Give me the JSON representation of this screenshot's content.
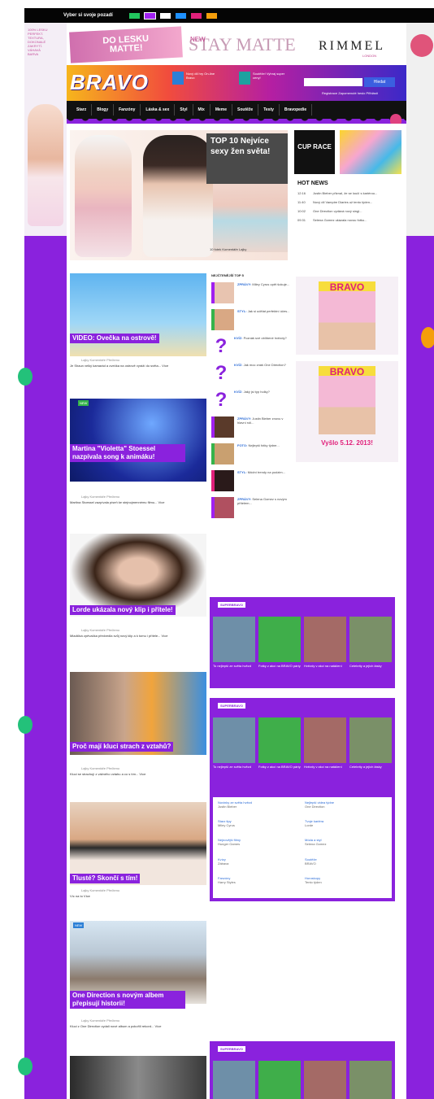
{
  "topbar": {
    "label": "Vyber si svoje pozadí",
    "swatches": [
      "#22c55e",
      "#a020f0",
      "#ffffff",
      "#1e90ff",
      "#e0207a",
      "#f59e0b"
    ]
  },
  "ads": {
    "left_text": "100% LESKU\nPERFEKT.\nTEXTURA,\nDOKONALÉ\nZAKRYTÍ.\nVÁHAVÁ\nBARVA",
    "lips_top": "DO LESKU",
    "lips_bottom": "MATTE!",
    "matte_new": "NEW",
    "matte": "STAY MATTE",
    "rimmel": "RIMMEL",
    "rimmel_sub": "LONDON"
  },
  "masthead": {
    "logo": "BRAVO",
    "item1": "Nový díl hry On-line Bravo",
    "item2": "Soutěže! Vyhraj super ceny!",
    "search_button": "Hledat",
    "register": "Registrace   Zapomenuté heslo   Přihlásit"
  },
  "nav": [
    "Starz",
    "Blogy",
    "Fanzóny",
    "Láska & sex",
    "Styl",
    "Mix",
    "Meme",
    "Soutěže",
    "Testy",
    "Bravopedie"
  ],
  "hero": {
    "title": "TOP 10 Nejvíce sexy žen světa!",
    "meta": "10 fotek   Komentáře   Lajky"
  },
  "sidebar_ads": {
    "cup": "CUP RACE"
  },
  "hot_news": {
    "title": "HOT NEWS",
    "items": [
      {
        "time": "12:16",
        "text": "Justin Bieber přiznal, že se loučí s kariérou..."
      },
      {
        "time": "11:40",
        "text": "Nový díl Vampire Diaries už tento týden..."
      },
      {
        "time": "10:02",
        "text": "One Direction vydává nový singl..."
      },
      {
        "time": "09:31",
        "text": "Selena Gomez ukázala novou fotku..."
      }
    ]
  },
  "articles": [
    {
      "title": "VIDEO: Ovečka na ostrově!",
      "meta": "Lajky   Komentáře   Přečteno",
      "text": "Je Shaun velký kamarád a ovečka na ostrově vyráží do světa... Více"
    },
    {
      "badge": "NEW",
      "title": "Martina \"Violetta\" Stoessel nazpívala song k animáku!",
      "meta": "Lajky   Komentáře   Přečteno",
      "text": "Martina Stoessel zazpívala píseň ke stejnojmennému filmu... Více"
    },
    {
      "title": "Lorde ukázala nový klip i přítele!",
      "meta": "Lajky   Komentáře   Přečteno",
      "text": "Mladičká zpěvačka předvedla svůj nový klip a k tomu i přítele... Více"
    },
    {
      "title": "Proč mají kluci strach z vztahů?",
      "meta": "Lajky   Komentáře   Přečteno",
      "text": "Kluci se strachují z vážného vztahu a co s tím... Více"
    },
    {
      "title": "Tlusté? Skončí s tím!",
      "meta": "Lajky   Komentáře   Přečteno",
      "text": "Víc na to Více"
    },
    {
      "badge": "NEW",
      "title": "One Direction s novým albem přepisují historii!",
      "meta": "Lajky   Komentáře   Přečteno",
      "text": "Kluci z One Direction vydali nové album a pokořili rekord... Více"
    }
  ],
  "top5": {
    "title": "NEJČTENĚJŠÍ TOP 5",
    "items": [
      {
        "head": "ZPRÁVY:",
        "text": "Miley Cyrus opět šokuje..."
      },
      {
        "head": "STYL:",
        "text": "Jak si udělat perfektní účes..."
      },
      {
        "head": "KVÍZ:",
        "text": "Poznáš své oblíbené hvězdy?"
      },
      {
        "head": "KVÍZ:",
        "text": "Jak moc znáš One Direction?"
      },
      {
        "head": "KVÍZ:",
        "text": "Jaký jsi typ holky?"
      },
      {
        "head": "ZPRÁVY:",
        "text": "Justin Bieber znovu v hlavní roli..."
      },
      {
        "head": "FOTO:",
        "text": "Nejlepší fotky týdne..."
      },
      {
        "head": "STYL:",
        "text": "Módní trendy na podzim..."
      },
      {
        "head": "ZPRÁVY:",
        "text": "Selena Gomez s novým přítelem..."
      }
    ]
  },
  "magazine": {
    "logo": "BRAVO",
    "date": "Vyšlo 5.12. 2013!"
  },
  "supermodule": {
    "label": "SUPERBRAVO",
    "captions": [
      "To nejlepší ze světa hvězd",
      "Fotky z akcí na BRAVO párty",
      "Hvězdy v akci na natáčení",
      "Celebrity a jejich lásky"
    ],
    "links": [
      {
        "text": "Novinky ze světa hvězd",
        "sub": "Justin Bieber"
      },
      {
        "text": "Nejlepší videa týdne",
        "sub": "One Direction"
      },
      {
        "text": "Starz tipy",
        "sub": "Miley Cyrus"
      },
      {
        "text": "Tvoje kariéra",
        "sub": "Lorde"
      },
      {
        "text": "Nejnovější filmy",
        "sub": "Hunger Games"
      },
      {
        "text": "Móda a styl",
        "sub": "Selena Gomez"
      },
      {
        "text": "Kvízy",
        "sub": "Zábava"
      },
      {
        "text": "Soutěže",
        "sub": "BRAVO"
      },
      {
        "text": "Fanzóny",
        "sub": "Harry Styles"
      },
      {
        "text": "Horoskopy",
        "sub": "Tento týden"
      }
    ]
  }
}
